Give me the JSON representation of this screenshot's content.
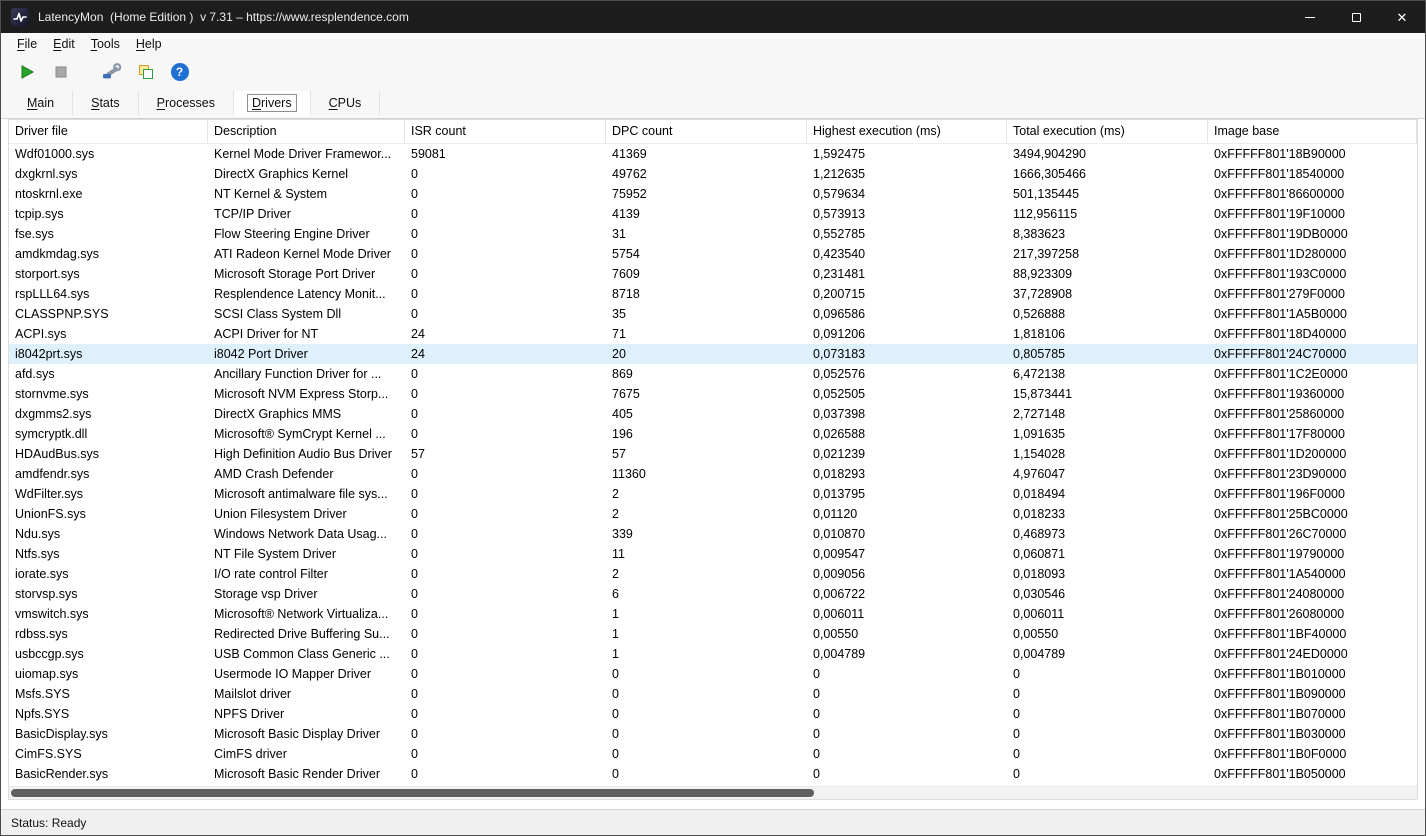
{
  "window": {
    "title": "LatencyMon  (Home Edition )  v 7.31 – https://www.resplendence.com",
    "controls": {
      "close_glyph": "✕"
    },
    "icons": [
      "app-icon",
      "minimize-icon",
      "maximize-icon",
      "close-icon"
    ]
  },
  "menu": {
    "items": [
      {
        "label": "File"
      },
      {
        "label": "Edit"
      },
      {
        "label": "Tools"
      },
      {
        "label": "Help"
      }
    ]
  },
  "toolbar": {
    "icons": [
      "play-icon",
      "stop-icon",
      "tools-icon",
      "windows-icon",
      "help-icon"
    ],
    "help_glyph": "?",
    "colors": {
      "play_green": "#27a527",
      "help_blue": "#1d6fd2"
    }
  },
  "tabs": {
    "selected_index": 3,
    "items": [
      {
        "label": "Main"
      },
      {
        "label": "Stats"
      },
      {
        "label": "Processes"
      },
      {
        "label": "Drivers"
      },
      {
        "label": "CPUs"
      }
    ]
  },
  "table": {
    "columns": [
      "Driver file",
      "Description",
      "ISR count",
      "DPC count",
      "Highest execution (ms)",
      "Total execution (ms)",
      "Image base"
    ],
    "selected_index": 10,
    "selected_row_color": "#def0fb",
    "rows": [
      [
        "Wdf01000.sys",
        "Kernel Mode Driver Framewor...",
        "59081",
        "41369",
        "1,592475",
        "3494,904290",
        "0xFFFFF801'18B90000"
      ],
      [
        "dxgkrnl.sys",
        "DirectX Graphics Kernel",
        "0",
        "49762",
        "1,212635",
        "1666,305466",
        "0xFFFFF801'18540000"
      ],
      [
        "ntoskrnl.exe",
        "NT Kernel & System",
        "0",
        "75952",
        "0,579634",
        "501,135445",
        "0xFFFFF801'86600000"
      ],
      [
        "tcpip.sys",
        "TCP/IP Driver",
        "0",
        "4139",
        "0,573913",
        "112,956115",
        "0xFFFFF801'19F10000"
      ],
      [
        "fse.sys",
        "Flow Steering Engine Driver",
        "0",
        "31",
        "0,552785",
        "8,383623",
        "0xFFFFF801'19DB0000"
      ],
      [
        "amdkmdag.sys",
        "ATI Radeon Kernel Mode Driver",
        "0",
        "5754",
        "0,423540",
        "217,397258",
        "0xFFFFF801'1D280000"
      ],
      [
        "storport.sys",
        "Microsoft Storage Port Driver",
        "0",
        "7609",
        "0,231481",
        "88,923309",
        "0xFFFFF801'193C0000"
      ],
      [
        "rspLLL64.sys",
        "Resplendence Latency Monit...",
        "0",
        "8718",
        "0,200715",
        "37,728908",
        "0xFFFFF801'279F0000"
      ],
      [
        "CLASSPNP.SYS",
        "SCSI Class System Dll",
        "0",
        "35",
        "0,096586",
        "0,526888",
        "0xFFFFF801'1A5B0000"
      ],
      [
        "ACPI.sys",
        "ACPI Driver for NT",
        "24",
        "71",
        "0,091206",
        "1,818106",
        "0xFFFFF801'18D40000"
      ],
      [
        "i8042prt.sys",
        "i8042 Port Driver",
        "24",
        "20",
        "0,073183",
        "0,805785",
        "0xFFFFF801'24C70000"
      ],
      [
        "afd.sys",
        "Ancillary Function Driver for ...",
        "0",
        "869",
        "0,052576",
        "6,472138",
        "0xFFFFF801'1C2E0000"
      ],
      [
        "stornvme.sys",
        "Microsoft NVM Express Storp...",
        "0",
        "7675",
        "0,052505",
        "15,873441",
        "0xFFFFF801'19360000"
      ],
      [
        "dxgmms2.sys",
        "DirectX Graphics MMS",
        "0",
        "405",
        "0,037398",
        "2,727148",
        "0xFFFFF801'25860000"
      ],
      [
        "symcryptk.dll",
        "Microsoft® SymCrypt Kernel ...",
        "0",
        "196",
        "0,026588",
        "1,091635",
        "0xFFFFF801'17F80000"
      ],
      [
        "HDAudBus.sys",
        "High Definition Audio Bus Driver",
        "57",
        "57",
        "0,021239",
        "1,154028",
        "0xFFFFF801'1D200000"
      ],
      [
        "amdfendr.sys",
        "AMD Crash Defender",
        "0",
        "11360",
        "0,018293",
        "4,976047",
        "0xFFFFF801'23D90000"
      ],
      [
        "WdFilter.sys",
        "Microsoft antimalware file sys...",
        "0",
        "2",
        "0,013795",
        "0,018494",
        "0xFFFFF801'196F0000"
      ],
      [
        "UnionFS.sys",
        "Union Filesystem Driver",
        "0",
        "2",
        "0,01120",
        "0,018233",
        "0xFFFFF801'25BC0000"
      ],
      [
        "Ndu.sys",
        "Windows Network Data Usag...",
        "0",
        "339",
        "0,010870",
        "0,468973",
        "0xFFFFF801'26C70000"
      ],
      [
        "Ntfs.sys",
        "NT File System Driver",
        "0",
        "11",
        "0,009547",
        "0,060871",
        "0xFFFFF801'19790000"
      ],
      [
        "iorate.sys",
        "I/O rate control Filter",
        "0",
        "2",
        "0,009056",
        "0,018093",
        "0xFFFFF801'1A540000"
      ],
      [
        "storvsp.sys",
        "Storage vsp Driver",
        "0",
        "6",
        "0,006722",
        "0,030546",
        "0xFFFFF801'24080000"
      ],
      [
        "vmswitch.sys",
        "Microsoft® Network Virtualiza...",
        "0",
        "1",
        "0,006011",
        "0,006011",
        "0xFFFFF801'26080000"
      ],
      [
        "rdbss.sys",
        "Redirected Drive Buffering Su...",
        "0",
        "1",
        "0,00550",
        "0,00550",
        "0xFFFFF801'1BF40000"
      ],
      [
        "usbccgp.sys",
        "USB Common Class Generic ...",
        "0",
        "1",
        "0,004789",
        "0,004789",
        "0xFFFFF801'24ED0000"
      ],
      [
        "uiomap.sys",
        "Usermode IO Mapper Driver",
        "0",
        "0",
        "0",
        "0",
        "0xFFFFF801'1B010000"
      ],
      [
        "Msfs.SYS",
        "Mailslot driver",
        "0",
        "0",
        "0",
        "0",
        "0xFFFFF801'1B090000"
      ],
      [
        "Npfs.SYS",
        "NPFS Driver",
        "0",
        "0",
        "0",
        "0",
        "0xFFFFF801'1B070000"
      ],
      [
        "BasicDisplay.sys",
        "Microsoft Basic Display Driver",
        "0",
        "0",
        "0",
        "0",
        "0xFFFFF801'1B030000"
      ],
      [
        "CimFS.SYS",
        "CimFS driver",
        "0",
        "0",
        "0",
        "0",
        "0xFFFFF801'1B0F0000"
      ],
      [
        "BasicRender.sys",
        "Microsoft Basic Render Driver",
        "0",
        "0",
        "0",
        "0",
        "0xFFFFF801'1B050000"
      ]
    ]
  },
  "status": {
    "label": "Status: Ready"
  }
}
